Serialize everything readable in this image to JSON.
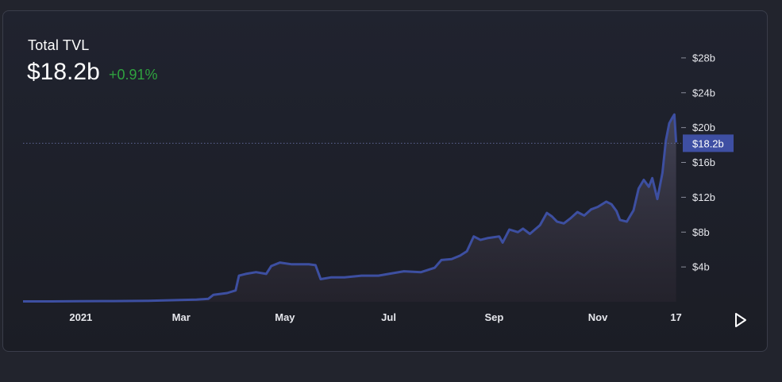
{
  "header": {
    "title": "Total TVL",
    "value": "$18.2b",
    "change": "+0.91%"
  },
  "colors": {
    "line": "#3d4fa1",
    "positive": "#2fa33f",
    "price_tag_bg": "#3e4fa3",
    "axis_text": "#e6e7ec"
  },
  "icons": {
    "play": "play-icon"
  },
  "chart_data": {
    "type": "area",
    "title": "Total TVL",
    "xlabel": "",
    "ylabel": "",
    "ylim": [
      0,
      31
    ],
    "y_ticks": [
      4,
      8,
      12,
      16,
      20,
      24,
      28
    ],
    "y_tick_labels": [
      "$4b",
      "$8b",
      "$12b",
      "$16b",
      "$20b",
      "$24b",
      "$28b"
    ],
    "x_tick_labels": [
      "2021",
      "Mar",
      "May",
      "Jul",
      "Sep",
      "Nov",
      "17"
    ],
    "x_tick_dates": [
      "2021-01-01",
      "2021-03-01",
      "2021-05-01",
      "2021-07-01",
      "2021-09-01",
      "2021-11-01",
      "2021-12-17"
    ],
    "current_label": "$18.2b",
    "current_value": 18.2,
    "grid": false,
    "legend": "none",
    "x_range": [
      "2020-11-28",
      "2021-12-20"
    ],
    "series": [
      {
        "points": [
          [
            "2020-11-28",
            0.05
          ],
          [
            "2020-12-15",
            0.05
          ],
          [
            "2021-01-01",
            0.06
          ],
          [
            "2021-01-20",
            0.08
          ],
          [
            "2021-02-10",
            0.12
          ],
          [
            "2021-02-28",
            0.2
          ],
          [
            "2021-03-10",
            0.25
          ],
          [
            "2021-03-17",
            0.35
          ],
          [
            "2021-03-20",
            0.8
          ],
          [
            "2021-03-28",
            1.0
          ],
          [
            "2021-04-02",
            1.3
          ],
          [
            "2021-04-04",
            3.0
          ],
          [
            "2021-04-08",
            3.2
          ],
          [
            "2021-04-14",
            3.4
          ],
          [
            "2021-04-20",
            3.2
          ],
          [
            "2021-04-23",
            4.1
          ],
          [
            "2021-04-28",
            4.5
          ],
          [
            "2021-05-05",
            4.3
          ],
          [
            "2021-05-15",
            4.3
          ],
          [
            "2021-05-19",
            4.2
          ],
          [
            "2021-05-22",
            2.6
          ],
          [
            "2021-05-28",
            2.8
          ],
          [
            "2021-06-05",
            2.8
          ],
          [
            "2021-06-15",
            3.0
          ],
          [
            "2021-06-25",
            3.0
          ],
          [
            "2021-07-01",
            3.2
          ],
          [
            "2021-07-10",
            3.5
          ],
          [
            "2021-07-20",
            3.4
          ],
          [
            "2021-07-28",
            3.9
          ],
          [
            "2021-08-01",
            4.8
          ],
          [
            "2021-08-07",
            4.9
          ],
          [
            "2021-08-12",
            5.3
          ],
          [
            "2021-08-16",
            5.8
          ],
          [
            "2021-08-20",
            7.5
          ],
          [
            "2021-08-24",
            7.1
          ],
          [
            "2021-08-28",
            7.3
          ],
          [
            "2021-09-04",
            7.5
          ],
          [
            "2021-09-06",
            6.8
          ],
          [
            "2021-09-10",
            8.3
          ],
          [
            "2021-09-15",
            8.0
          ],
          [
            "2021-09-18",
            8.4
          ],
          [
            "2021-09-22",
            7.8
          ],
          [
            "2021-09-28",
            8.8
          ],
          [
            "2021-10-02",
            10.2
          ],
          [
            "2021-10-05",
            9.8
          ],
          [
            "2021-10-08",
            9.2
          ],
          [
            "2021-10-12",
            9.0
          ],
          [
            "2021-10-16",
            9.6
          ],
          [
            "2021-10-20",
            10.3
          ],
          [
            "2021-10-24",
            9.9
          ],
          [
            "2021-10-28",
            10.6
          ],
          [
            "2021-11-01",
            10.9
          ],
          [
            "2021-11-06",
            11.5
          ],
          [
            "2021-11-09",
            11.2
          ],
          [
            "2021-11-12",
            10.4
          ],
          [
            "2021-11-14",
            9.4
          ],
          [
            "2021-11-18",
            9.2
          ],
          [
            "2021-11-22",
            10.5
          ],
          [
            "2021-11-25",
            13.0
          ],
          [
            "2021-11-28",
            14.0
          ],
          [
            "2021-12-01",
            13.2
          ],
          [
            "2021-12-03",
            14.2
          ],
          [
            "2021-12-06",
            11.8
          ],
          [
            "2021-12-09",
            14.8
          ],
          [
            "2021-12-11",
            18.5
          ],
          [
            "2021-12-13",
            20.5
          ],
          [
            "2021-12-15",
            21.2
          ],
          [
            "2021-12-16",
            21.5
          ],
          [
            "2021-12-17",
            18.3
          ]
        ]
      }
    ]
  }
}
